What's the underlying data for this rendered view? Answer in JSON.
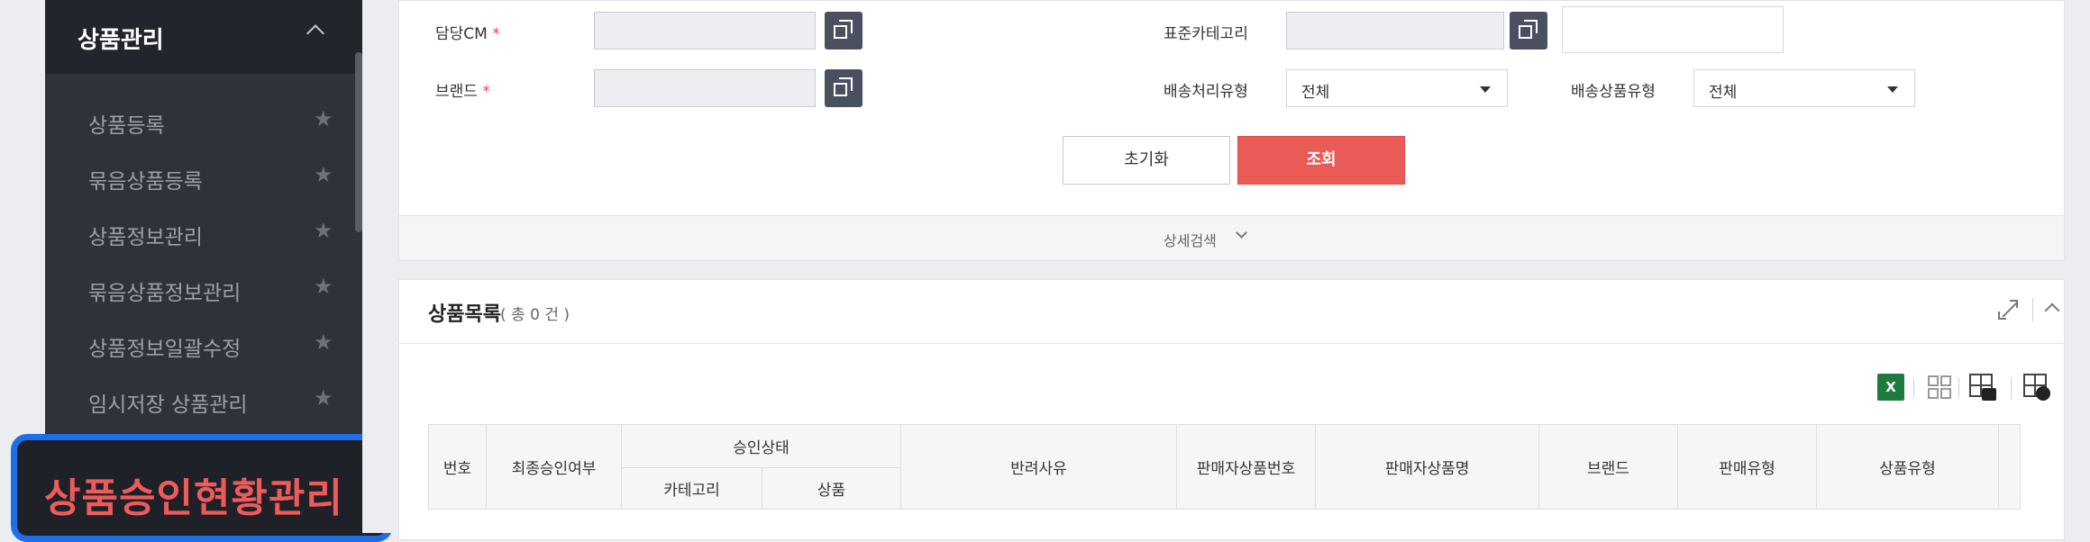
{
  "sidebar": {
    "section_title": "상품관리",
    "items": [
      {
        "label": "상품등록"
      },
      {
        "label": "묶음상품등록"
      },
      {
        "label": "상품정보관리"
      },
      {
        "label": "묶음상품정보관리"
      },
      {
        "label": "상품정보일괄수정"
      },
      {
        "label": "임시저장 상품관리"
      }
    ],
    "highlighted_item": "상품승인현황관리",
    "star_glyph": "★"
  },
  "search": {
    "cm_label": "담당CM",
    "brand_label": "브랜드",
    "required_mark": "*",
    "category_label": "표준카테고리",
    "delivery_type_label": "배송처리유형",
    "delivery_type_value": "전체",
    "delivery_product_label": "배송상품유형",
    "delivery_product_value": "전체",
    "reset_label": "초기화",
    "search_label": "조회",
    "detail_search_label": "상세검색"
  },
  "list": {
    "title": "상품목록",
    "count_text": "( 총 0 건 )",
    "excel_label": "X",
    "columns": {
      "no": "번호",
      "final_approval": "최종승인여부",
      "approval_status": "승인상태",
      "category": "카테고리",
      "product": "상품",
      "reject_reason": "반려사유",
      "seller_product_no": "판매자상품번호",
      "seller_product_name": "판매자상품명",
      "brand": "브랜드",
      "sale_type": "판매유형",
      "product_type": "상품유형"
    }
  },
  "colors": {
    "sidebar_bg": "#2f323a",
    "highlight_border": "#1e6ee8",
    "highlight_text": "#ef5a5a",
    "search_button": "#ea5a57",
    "excel_icon": "#1e7a3e"
  }
}
